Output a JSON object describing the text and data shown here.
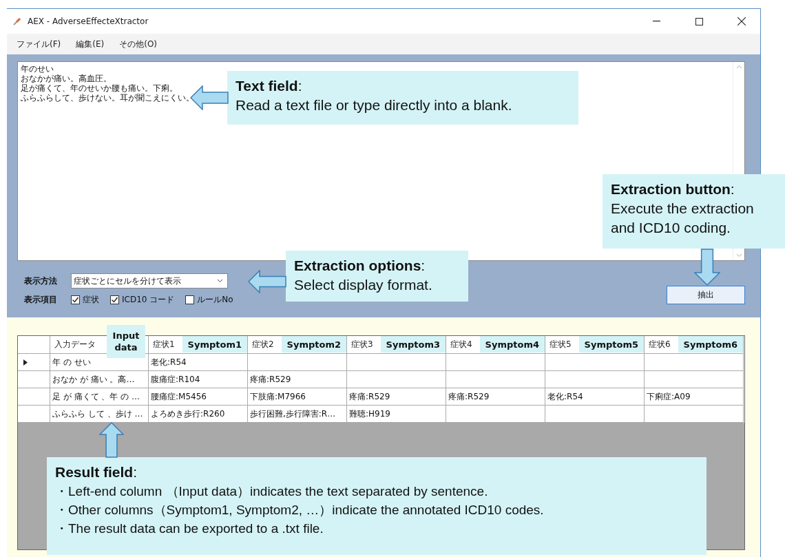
{
  "window": {
    "title": "AEX - AdverseEffecteXtractor"
  },
  "menu": [
    "ファイル(F)",
    "編集(E)",
    "その他(O)"
  ],
  "text_field": {
    "lines": [
      "年のせい",
      "おなかが痛い。高血圧。",
      "足が痛くて、年のせいか腰も痛い。下痢。",
      "ふらふらして、歩けない。耳が聞こえにくい。"
    ]
  },
  "display_method": {
    "label": "表示方法",
    "value": "症状ごとにセルを分けて表示"
  },
  "display_items": {
    "label": "表示項目",
    "options": [
      {
        "label": "症状",
        "checked": true
      },
      {
        "label": "ICD10 コード",
        "checked": true
      },
      {
        "label": "ルールNo",
        "checked": false
      }
    ]
  },
  "extract_button": "抽出",
  "grid": {
    "columns": [
      {
        "label": "入力データ",
        "note": "Input data"
      },
      {
        "label": "症状1",
        "note": "Symptom1"
      },
      {
        "label": "症状2",
        "note": "Symptom2"
      },
      {
        "label": "症状3",
        "note": "Symptom3"
      },
      {
        "label": "症状4",
        "note": "Symptom4"
      },
      {
        "label": "症状5",
        "note": "Symptom5"
      },
      {
        "label": "症状6",
        "note": "Symptom6"
      }
    ],
    "rows": [
      {
        "selected": true,
        "cells": [
          "年 の せい",
          "老化:R54",
          "",
          "",
          "",
          "",
          ""
        ]
      },
      {
        "selected": false,
        "cells": [
          "おなか が 痛い 。高…",
          "腹痛症:R104",
          "疼痛:R529",
          "",
          "",
          "",
          ""
        ]
      },
      {
        "selected": false,
        "cells": [
          "足 が 痛くて 、年 の …",
          "腰痛症:M5456",
          "下肢痛:M7966",
          "疼痛:R529",
          "疼痛:R529",
          "老化:R54",
          "下痢症:A09"
        ]
      },
      {
        "selected": false,
        "cells": [
          "ふらふら して 、歩け …",
          "よろめき歩行:R260",
          "歩行困難,歩行障害:R…",
          "難聴:H919",
          "",
          "",
          ""
        ]
      }
    ]
  },
  "callouts": [
    {
      "kind": "text",
      "title": "**Text field**:",
      "body": [
        "Read a text file or type directly into a blank."
      ]
    },
    {
      "kind": "button",
      "title": "**Extraction button**:",
      "body": [
        "Execute the extraction",
        "and ICD10 coding."
      ]
    },
    {
      "kind": "options",
      "title": "**Extraction options**:",
      "body": [
        "Select display format."
      ]
    },
    {
      "kind": "result",
      "title": "**Result field**:",
      "body": [
        "・Left-end column （Input data）indicates the text separated by sentence.",
        "・Other columns（Symptom1, Symptom2, …）indicate the annotated ICD10 codes.",
        "・The result data can be exported to a .txt file."
      ]
    }
  ]
}
